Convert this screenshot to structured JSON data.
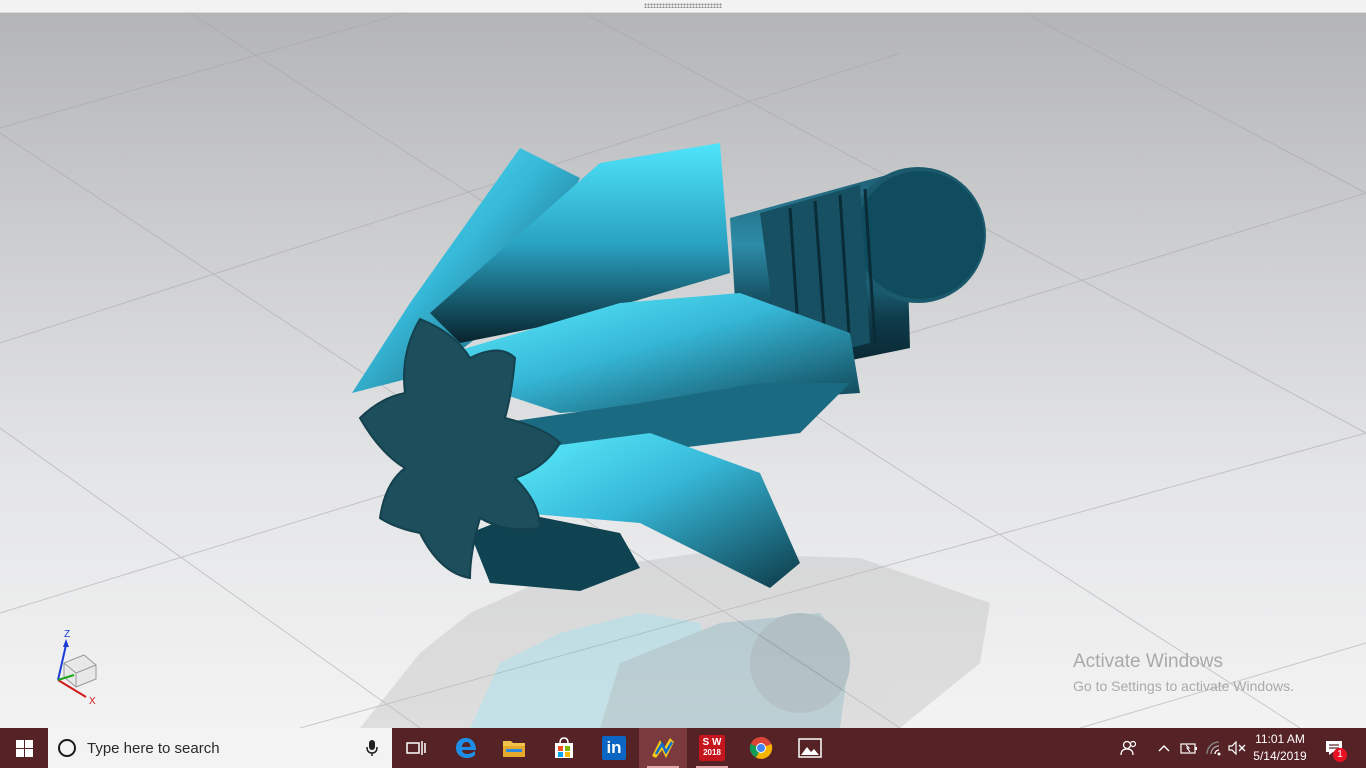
{
  "viewport": {
    "axis_labels": {
      "z": "Z",
      "x": "X"
    }
  },
  "watermark": {
    "title": "Activate Windows",
    "subtitle": "Go to Settings to activate Windows."
  },
  "taskbar": {
    "search_placeholder": "Type here to search",
    "apps": [
      {
        "name": "Task View",
        "icon": "task-view-icon"
      },
      {
        "name": "Microsoft Edge",
        "icon": "edge-icon"
      },
      {
        "name": "File Explorer",
        "icon": "folder-icon"
      },
      {
        "name": "Microsoft Store",
        "icon": "store-icon"
      },
      {
        "name": "LinkedIn",
        "icon": "linkedin-icon",
        "text": "in"
      },
      {
        "name": "NX",
        "icon": "nx-icon"
      },
      {
        "name": "SolidWorks 2018",
        "icon": "solidworks-icon",
        "text": "2018"
      },
      {
        "name": "Google Chrome",
        "icon": "chrome-icon"
      },
      {
        "name": "Photos",
        "icon": "photos-icon"
      }
    ],
    "clock": {
      "time": "11:01 AM",
      "date": "5/14/2019"
    },
    "notification_count": "1"
  },
  "colors": {
    "taskbar": "#552225",
    "gear_light": "#3fd0ec",
    "gear_dark": "#0f3d4c",
    "gear_face": "#1c4e5c"
  }
}
